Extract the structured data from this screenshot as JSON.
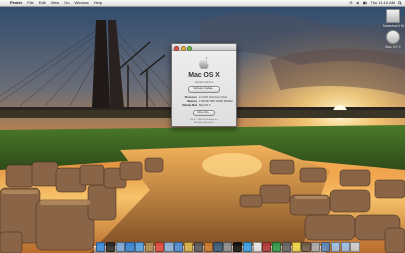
{
  "menubar": {
    "apple_glyph": "",
    "menus": [
      "Finder",
      "File",
      "Edit",
      "View",
      "Go",
      "Window",
      "Help"
    ],
    "clock": "Thu 11:10 AM"
  },
  "desktop_icons": [
    {
      "label": "Macintosh HD",
      "icon": "hard-drive-icon"
    },
    {
      "label": "Mac OS X",
      "icon": "disk-icon"
    }
  ],
  "about_window": {
    "os_name": "Mac OS X",
    "version": "Version 10.6.4",
    "update_button": "Software Update...",
    "processor_label": "Processor",
    "processor_value": "2.4 GHz Intel Core 2 Duo",
    "memory_label": "Memory",
    "memory_value": "4 GB 667 MHz DDR2 SDRAM",
    "startup_label": "Startup Disk",
    "startup_value": "Mac OS X",
    "more_info_button": "More Info...",
    "footer_line1": "TM & © 1983-2010 Apple Inc.",
    "footer_line2": "All Rights Reserved."
  },
  "dock": {
    "items": [
      {
        "name": "Finder",
        "icon": "finder-icon",
        "color": "#3d8be0"
      },
      {
        "name": "Dashboard",
        "icon": "dashboard-icon",
        "color": "#2b2b2b"
      },
      {
        "name": "Mail",
        "icon": "mail-icon",
        "color": "#7faad6"
      },
      {
        "name": "Safari",
        "icon": "safari-icon",
        "color": "#3a86d8"
      },
      {
        "name": "iChat",
        "icon": "chat-icon",
        "color": "#5aa3e6"
      },
      {
        "name": "Address Book",
        "icon": "address-book-icon",
        "color": "#b08a52"
      },
      {
        "name": "iCal",
        "icon": "calendar-icon",
        "color": "#e24b3f"
      },
      {
        "name": "Preview",
        "icon": "preview-icon",
        "color": "#8fb3d9"
      },
      {
        "name": "iTunes",
        "icon": "music-icon",
        "color": "#4f8fd8"
      },
      {
        "name": "iPhoto",
        "icon": "photo-icon",
        "color": "#d9b34a"
      },
      {
        "name": "iMovie",
        "icon": "movie-icon",
        "color": "#5a5a5a"
      },
      {
        "name": "GarageBand",
        "icon": "guitar-icon",
        "color": "#c97a2a"
      },
      {
        "name": "Time Machine",
        "icon": "time-machine-icon",
        "color": "#3b5a7a"
      },
      {
        "name": "System Preferences",
        "icon": "gear-icon",
        "color": "#8d8d8d"
      },
      {
        "name": "Terminal",
        "icon": "terminal-icon",
        "color": "#111111"
      },
      {
        "name": "App Store",
        "icon": "app-store-icon",
        "color": "#3aa0e6"
      },
      {
        "name": "TextEdit",
        "icon": "text-edit-icon",
        "color": "#e8e8e8"
      },
      {
        "name": "Photo Booth",
        "icon": "camera-icon",
        "color": "#b23a3a"
      },
      {
        "name": "Activity Monitor",
        "icon": "activity-icon",
        "color": "#2f9a4a"
      },
      {
        "name": "Calculator",
        "icon": "calculator-icon",
        "color": "#666666"
      },
      {
        "name": "Stickies",
        "icon": "note-icon",
        "color": "#f1d64b"
      },
      {
        "name": "Chess",
        "icon": "chess-icon",
        "color": "#6b5a45"
      },
      {
        "name": "Font Book",
        "icon": "font-icon",
        "color": "#a8a8a8"
      },
      {
        "name": "Image Capture",
        "icon": "image-capture-icon",
        "color": "#5b86b8"
      },
      {
        "name": "Downloads",
        "icon": "downloads-folder-icon",
        "color": "#9ec3ea"
      },
      {
        "name": "Documents",
        "icon": "documents-folder-icon",
        "color": "#9ec3ea"
      },
      {
        "name": "Trash",
        "icon": "trash-icon",
        "color": "#cfd3d8"
      }
    ]
  },
  "colors": {
    "sky_top": "#3b5f86",
    "sky_glow": "#ffb347",
    "sun": "#fff4c8",
    "grass": "#4f8a2a",
    "water": "#d98a3a",
    "rock": "#a07a5a"
  }
}
